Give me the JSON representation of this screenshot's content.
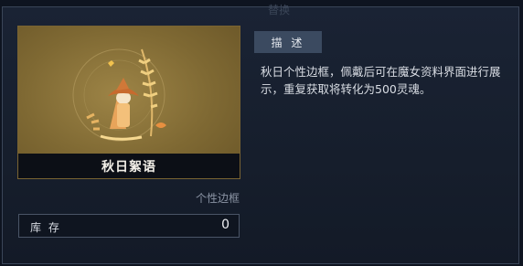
{
  "header": {
    "ghost_title": "替换"
  },
  "item": {
    "name": "秋日絮语",
    "type": "个性边框",
    "stock_label": "库 存",
    "stock_value": "0"
  },
  "description": {
    "tab_label": "描 述",
    "text": "秋日个性边框，佩戴后可在魔女资料界面进行展示，重复获取将转化为500灵魂。"
  },
  "colors": {
    "card_gold": "#8f7a3e",
    "panel_bg": "#161e2c",
    "tab_bg": "#3b4a60"
  }
}
